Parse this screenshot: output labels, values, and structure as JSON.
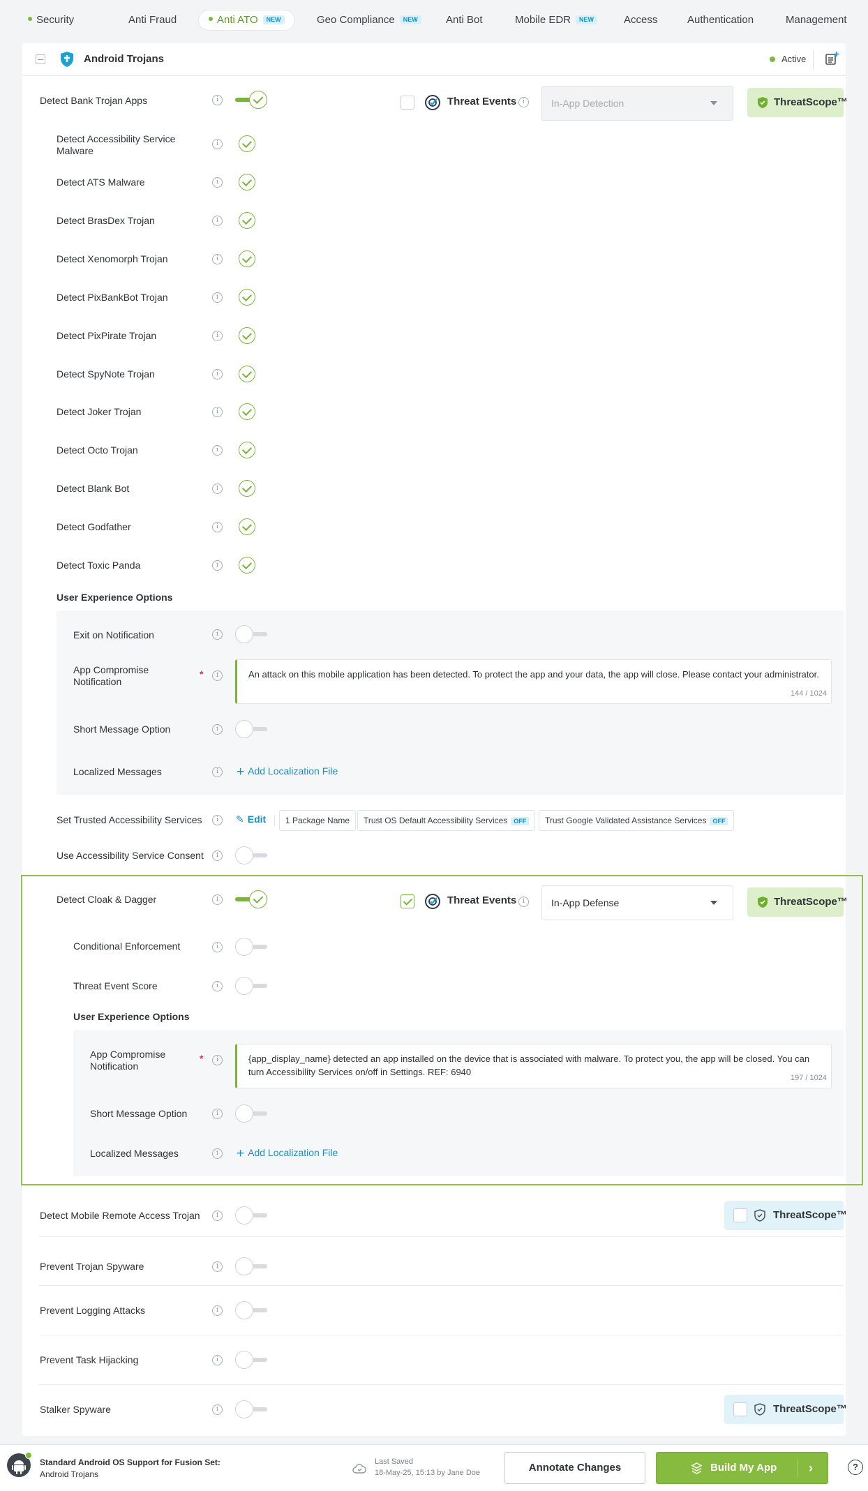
{
  "nav": {
    "items": [
      {
        "label": "Security",
        "dot": true,
        "new": false,
        "active": false
      },
      {
        "label": "Anti Fraud",
        "dot": false,
        "new": false,
        "active": false
      },
      {
        "label": "Anti ATO",
        "dot": true,
        "new": true,
        "active": true
      },
      {
        "label": "Geo Compliance",
        "dot": false,
        "new": true,
        "active": false
      },
      {
        "label": "Anti Bot",
        "dot": false,
        "new": false,
        "active": false
      },
      {
        "label": "Mobile EDR",
        "dot": false,
        "new": true,
        "active": false
      },
      {
        "label": "Access",
        "dot": false,
        "new": false,
        "active": false
      },
      {
        "label": "Authentication",
        "dot": false,
        "new": false,
        "active": false
      },
      {
        "label": "Management",
        "dot": false,
        "new": false,
        "active": false
      }
    ],
    "new_badge": "NEW"
  },
  "header": {
    "title": "Android Trojans",
    "status": "Active"
  },
  "bank_trojan": {
    "label": "Detect Bank Trojan Apps",
    "threat_events_label": "Threat Events",
    "select_placeholder": "In-App Detection",
    "threatscope_label": "ThreatScope™",
    "children": [
      "Detect Accessibility Service Malware",
      "Detect ATS Malware",
      "Detect BrasDex Trojan",
      "Detect Xenomorph Trojan",
      "Detect PixBankBot Trojan",
      "Detect PixPirate Trojan",
      "Detect SpyNote Trojan",
      "Detect Joker Trojan",
      "Detect Octo Trojan",
      "Detect Blank Bot",
      "Detect Godfather",
      "Detect Toxic Panda"
    ],
    "ux_title": "User Experience Options",
    "exit_on_notification": "Exit on Notification",
    "app_compromise_label": "App Compromise Notification",
    "app_compromise_text": "An attack on this mobile application has been detected. To protect the app and your data, the app will close. Please contact your administrator.",
    "app_compromise_count": "144 / 1024",
    "short_message": "Short Message Option",
    "localized": "Localized Messages",
    "add_localization": "Add Localization File",
    "trusted_label": "Set Trusted Accessibility Services",
    "edit_label": "Edit",
    "pill_package": "1 Package Name",
    "pill_os": "Trust OS Default Accessibility Services",
    "pill_google": "Trust Google Validated Assistance Services",
    "off_badge": "OFF",
    "consent_label": "Use Accessibility Service Consent"
  },
  "cloak": {
    "label": "Detect Cloak & Dagger",
    "threat_events_label": "Threat Events",
    "select_value": "In-App Defense",
    "threatscope_label": "ThreatScope™",
    "conditional": "Conditional Enforcement",
    "score": "Threat Event Score",
    "ux_title": "User Experience Options",
    "app_compromise_label": "App Compromise Notification",
    "app_compromise_text": "{app_display_name} detected an app installed on the device that is associated with malware. To protect you, the app will be closed. You can turn Accessibility Services on/off in Settings. REF: 6940",
    "app_compromise_count": "197 / 1024",
    "short_message": "Short Message Option",
    "localized": "Localized Messages",
    "add_localization": "Add Localization File"
  },
  "bottom_rows": [
    {
      "label": "Detect Mobile Remote Access Trojan",
      "threatscope": true
    },
    {
      "label": "Prevent Trojan Spyware",
      "threatscope": false
    },
    {
      "label": "Prevent Logging Attacks",
      "threatscope": false
    },
    {
      "label": "Prevent Task Hijacking",
      "threatscope": false
    },
    {
      "label": "Stalker Spyware",
      "threatscope": true
    }
  ],
  "threatscope_label": "ThreatScope™",
  "footer": {
    "support_line1": "Standard Android OS Support for Fusion Set:",
    "support_line2": "Android Trojans",
    "saved_label": "Last Saved",
    "saved_value": "18-May-25, 15:13 by Jane Doe",
    "annotate": "Annotate Changes",
    "build": "Build My App",
    "help": "?"
  },
  "colors": {
    "accent_green": "#79b53b",
    "link_blue": "#1a8fc0",
    "selection_border": "#8fc14a"
  }
}
